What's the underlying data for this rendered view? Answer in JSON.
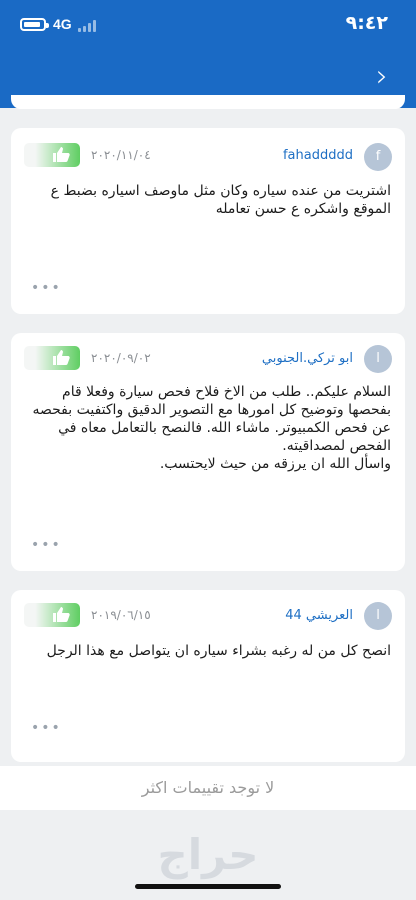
{
  "status_bar": {
    "network": "4G",
    "time": "٩:٤٢",
    "battery_icon": "battery-icon"
  },
  "header": {
    "back_icon": "chevron-right-icon",
    "background": "#1a6ac5"
  },
  "reviews": [
    {
      "avatar": "f",
      "name": "fahaddddd",
      "date": "٢٠٢٠/١١/٠٤",
      "text": "اشتريت من عنده سياره وكان مثل ماوصف اسياره بضبط ع الموقع واشكره ع حسن تعامله",
      "more": "•••",
      "like_icon": "thumbs-up-icon"
    },
    {
      "avatar": "ا",
      "name": "ابو تركي.الجنوبي",
      "date": "٢٠٢٠/٠٩/٠٢",
      "text": "السلام عليكم.. طلب من الاخ فلاح فحص سيارة وفعلا  قام بفحصها وتوضيح كل امورها مع التصوير الدقيق واكتفيت بفحصه عن فحص الكمبيوتر. ماشاء الله. فالنصح بالتعامل معاه في الفحص لمصداقيته.\nواسأل الله ان يرزقه من حيث لايحتسب.",
      "more": "•••",
      "like_icon": "thumbs-up-icon"
    },
    {
      "avatar": "ا",
      "name": "العريشي 44",
      "date": "٢٠١٩/٠٦/١٥",
      "text": "انصح كل من له رغبه بشراء سياره ان يتواصل مع هذا الرجل",
      "more": "•••",
      "like_icon": "thumbs-up-icon"
    }
  ],
  "footer": {
    "no_more": "لا توجد تقييمات اكثر",
    "logo": "حراج"
  }
}
